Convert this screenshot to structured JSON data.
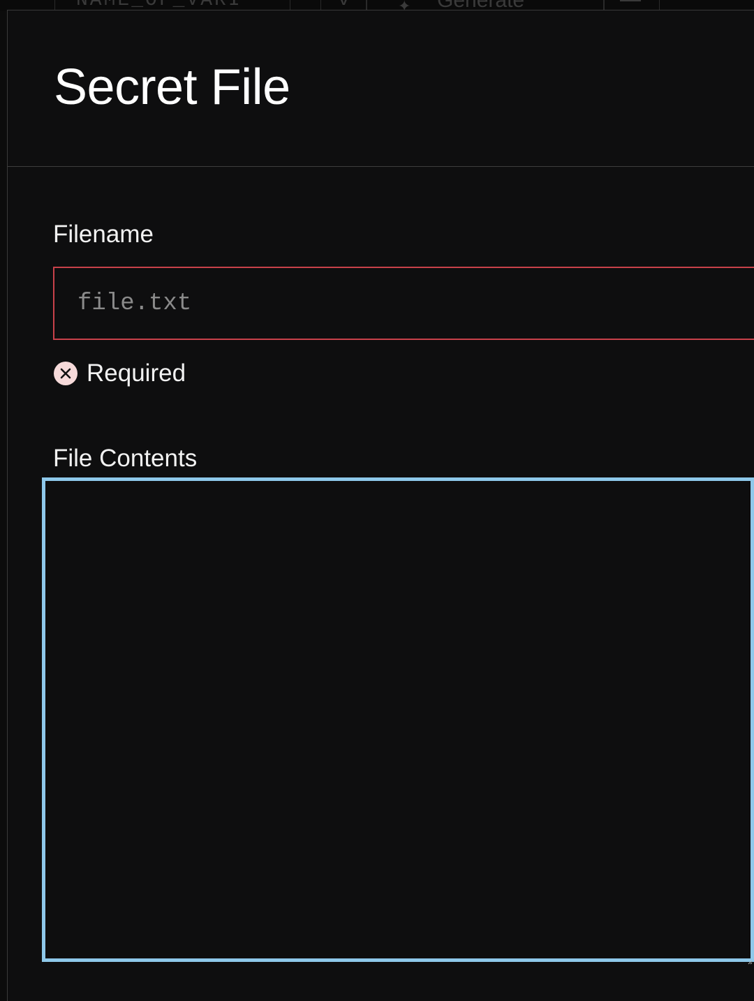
{
  "background_row": {
    "name_field_text": "NAME_OF_VARI",
    "toggle_text": "v",
    "generate_label": "Generate"
  },
  "modal": {
    "title": "Secret File",
    "filename": {
      "label": "Filename",
      "value": "",
      "placeholder": "file.txt",
      "error": "Required"
    },
    "file_contents": {
      "label": "File Contents",
      "value": ""
    }
  },
  "colors": {
    "modal_background": "#0e0e0f",
    "error_border": "#c8414a",
    "focus_border": "#8ec8ea",
    "error_icon_fill": "#f6dada",
    "text_primary": "#ffffff"
  },
  "icons": {
    "error": "x-circle-icon",
    "generate": "magic-wand-icon",
    "delete": "trash-icon"
  }
}
